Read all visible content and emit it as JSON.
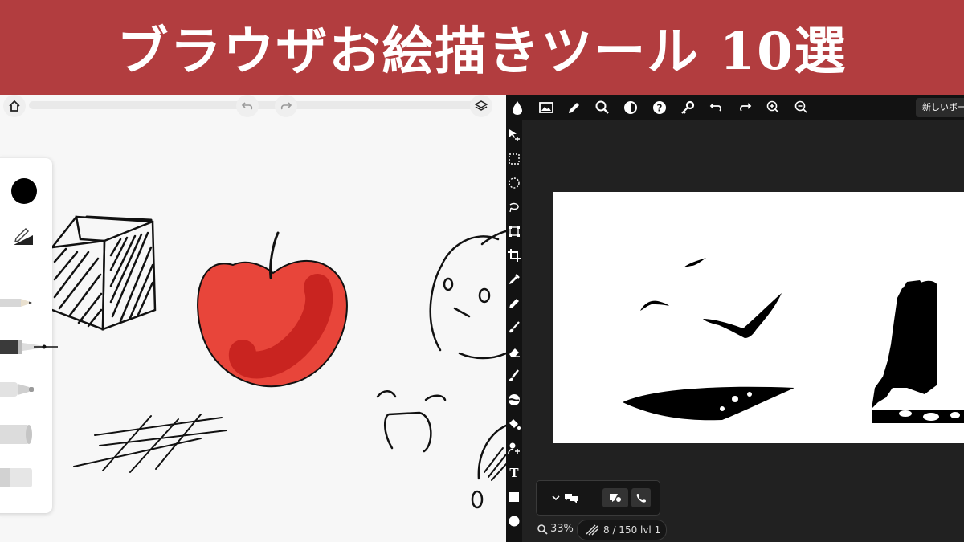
{
  "banner": {
    "title": "ブラウザお絵描きツール 10選",
    "bg": "#b23d3f"
  },
  "left_app": {
    "icons": [
      "home-icon",
      "undo-icon",
      "redo-icon",
      "layers-icon"
    ],
    "tools": [
      "color-swatch",
      "pen-settings-icon",
      "pencil-tool",
      "fountain-pen-tool",
      "marker-tool",
      "chalk-tool",
      "eraser-tool"
    ],
    "selected_color": "#000000"
  },
  "right_app": {
    "toolbar_icons": [
      "app-logo-icon",
      "image-icon",
      "pencil-icon",
      "search-icon",
      "contrast-icon",
      "help-icon",
      "key-icon",
      "undo-icon",
      "redo-icon",
      "zoom-in-icon",
      "zoom-out-icon"
    ],
    "new_board_label": "新しいボー",
    "side_tools": [
      "move-icon",
      "rect-select-icon",
      "ellipse-select-icon",
      "lasso-icon",
      "transform-icon",
      "crop-icon",
      "eyedropper-icon",
      "pencil-icon",
      "brush-icon",
      "eraser-icon",
      "smudge-icon",
      "blur-icon",
      "fill-icon",
      "clone-icon",
      "text-tool",
      "rectangle-icon",
      "circle-icon"
    ],
    "text_tool_label": "T",
    "zoom": "33%",
    "status": {
      "count": "8 / 150",
      "level": "lvl 1"
    }
  }
}
